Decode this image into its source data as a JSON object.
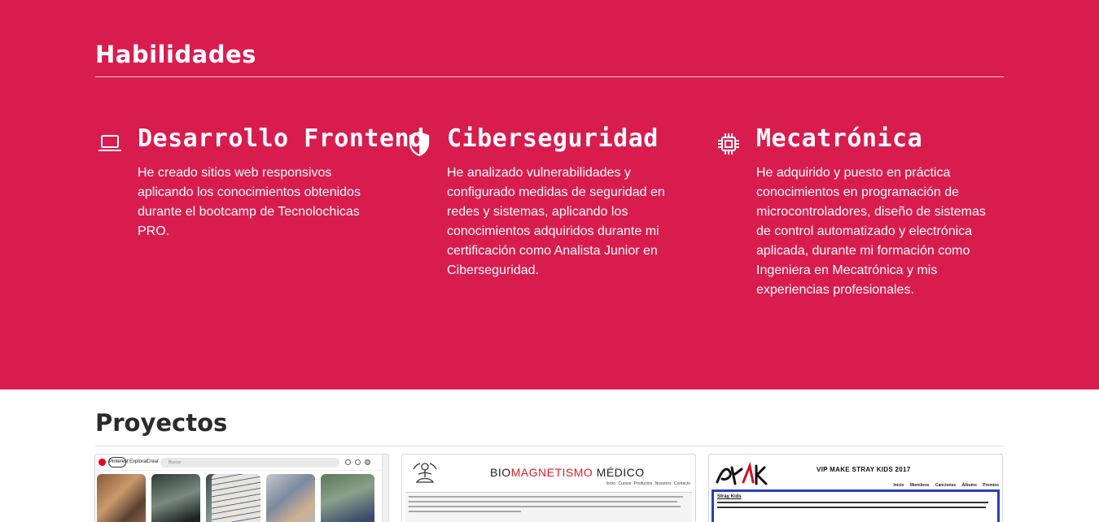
{
  "skills": {
    "title": "Habilidades",
    "items": [
      {
        "icon": "laptop-icon",
        "name": "Desarrollo Frontend",
        "description": "He creado sitios web responsivos aplicando los conocimientos obtenidos durante el bootcamp de Tecnolochicas PRO."
      },
      {
        "icon": "shield-icon",
        "name": "Ciberseguridad",
        "description": "He analizado vulnerabilidades y configurado medidas de seguridad en redes y sistemas, aplicando los conocimientos adquiridos durante mi certificación como Analista Junior en Ciberseguridad."
      },
      {
        "icon": "chip-icon",
        "name": "Mecatrónica",
        "description": "He adquirido y puesto en práctica conocimientos en programación de microcontroladores, diseño de sistemas de control automatizado y electrónica aplicada, durante mi formación como Ingeniera en Mecatrónica y mis experiencias profesionales."
      }
    ]
  },
  "projects": {
    "title": "Proyectos",
    "card1": {
      "logo": "Pinterest",
      "nav": [
        "Explorar",
        "Crear"
      ],
      "search_placeholder": "Buscar"
    },
    "card2": {
      "title_prefix": "BIO",
      "title_accent": "MAGNETISMO",
      "title_suffix": " MÉDICO",
      "nav": "Inicio Cursos Productos Nosotros Contacto"
    },
    "card3": {
      "title": "VIP MAKE STRAY KIDS 2017",
      "nav": "Inicio Miembros Canciones Álbums Premios",
      "section_label": "Stray Kids"
    }
  },
  "colors": {
    "accent": "#d91c4e",
    "text_light": "#ffffff",
    "text_dark": "#2a2a2a"
  }
}
